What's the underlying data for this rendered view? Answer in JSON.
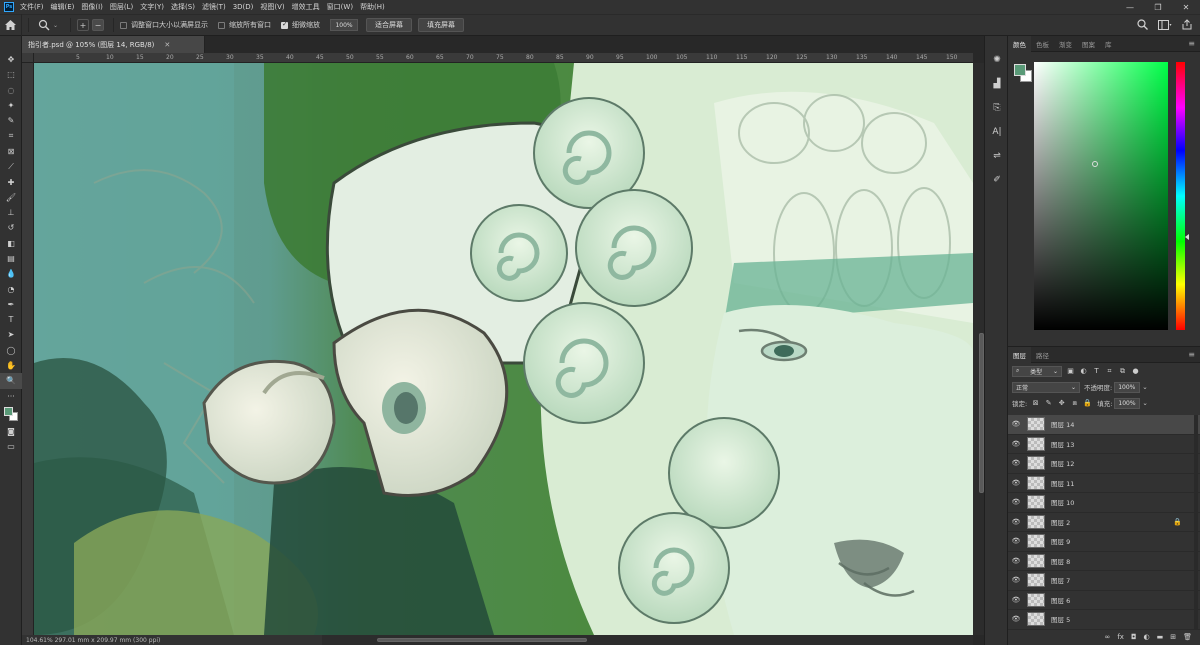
{
  "menu": {
    "items": [
      "文件(F)",
      "编辑(E)",
      "图像(I)",
      "图层(L)",
      "文字(Y)",
      "选择(S)",
      "滤镜(T)",
      "3D(D)",
      "视图(V)",
      "增效工具",
      "窗口(W)",
      "帮助(H)"
    ]
  },
  "options": {
    "resize_windows": "调整窗口大小以满屏显示",
    "zoom_all": "缩放所有窗口",
    "scrubby_zoom": "细微缩放",
    "zoom_value": "100%",
    "fit_screen": "适合屏幕",
    "fill_screen": "填充屏幕"
  },
  "document": {
    "tab_title": "指引者.psd @ 105% (图层 14, RGB/8)",
    "status": "104.61%   297.01 mm x 209.97 mm (300 ppi)",
    "ruler_ticks": [
      "5",
      "10",
      "15",
      "20",
      "25",
      "30",
      "35",
      "40",
      "45",
      "50",
      "55",
      "60",
      "65",
      "70",
      "75",
      "80",
      "85",
      "90",
      "95",
      "100",
      "105",
      "110",
      "115",
      "120",
      "125",
      "130",
      "135",
      "140",
      "145",
      "150",
      "155",
      "160"
    ]
  },
  "color_panel": {
    "tabs": [
      "颜色",
      "色板",
      "渐变",
      "图案",
      "库"
    ],
    "foreground": "#5a9a78",
    "background": "#ffffff"
  },
  "layers_panel": {
    "tabs": [
      "图层",
      "路径"
    ],
    "filter_kind": "类型",
    "blend_mode": "正常",
    "opacity_label": "不透明度:",
    "opacity": "100%",
    "lock_label": "锁定:",
    "fill_label": "填充:",
    "fill": "100%",
    "layers": [
      {
        "name": "图层 14",
        "selected": true,
        "locked": false
      },
      {
        "name": "图层 13",
        "selected": false,
        "locked": false
      },
      {
        "name": "图层 12",
        "selected": false,
        "locked": false
      },
      {
        "name": "图层 11",
        "selected": false,
        "locked": false
      },
      {
        "name": "图层 10",
        "selected": false,
        "locked": false
      },
      {
        "name": "图层 2",
        "selected": false,
        "locked": true
      },
      {
        "name": "图层 9",
        "selected": false,
        "locked": false
      },
      {
        "name": "图层 8",
        "selected": false,
        "locked": false
      },
      {
        "name": "图层 7",
        "selected": false,
        "locked": false
      },
      {
        "name": "图层 6",
        "selected": false,
        "locked": false
      },
      {
        "name": "图层 5",
        "selected": false,
        "locked": false
      }
    ]
  }
}
